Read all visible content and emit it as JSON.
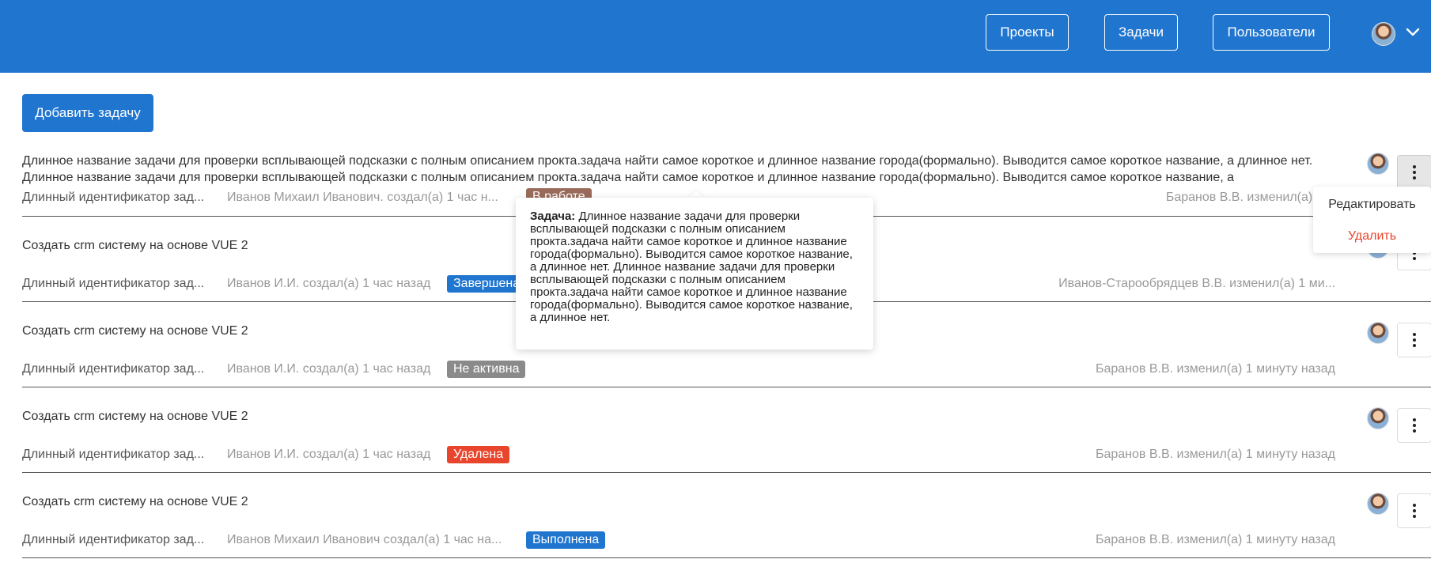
{
  "header": {
    "nav": [
      "Проекты",
      "Задачи",
      "Пользователи"
    ],
    "avatar_icon": "user-avatar",
    "dropdown_icon": "chevron-down-icon"
  },
  "add_button": "Добавить задачу",
  "tasks": [
    {
      "title": "Длинное название задачи для проверки всплывающей подсказки с полным описанием прокта.задача найти самое короткое и длинное название города(формально). Выводится самое короткое название, а длинное нет. Длинное название задачи для проверки всплывающей подсказки с полным описанием прокта.задача найти самое короткое и длинное название города(формально). Выводится самое короткое название, а",
      "identifier": "Длинный идентификатор зад...",
      "creator": "Иванов Михаил Иванович. создал(а) 1 час н...",
      "status": "В работе",
      "status_color": "#9a6b5a",
      "changer": "Баранов В.В. изменил(а) 1 м"
    },
    {
      "title": "Создать crm систему на основе VUE 2",
      "identifier": "Длинный идентификатор зад...",
      "creator": "Иванов И.И. создал(а) 1 час назад",
      "status": "Завершена",
      "status_color": "#2075cf",
      "changer": "Иванов-Старообрядцев В.В. изменил(а) 1 ми..."
    },
    {
      "title": "Создать crm систему на основе VUE 2",
      "identifier": "Длинный идентификатор зад...",
      "creator": "Иванов И.И. создал(а) 1 час назад",
      "status": "Не активна",
      "status_color": "#8a8a8a",
      "changer": "Баранов В.В. изменил(а) 1 минуту назад"
    },
    {
      "title": "Создать crm систему на основе VUE 2",
      "identifier": "Длинный идентификатор зад...",
      "creator": "Иванов И.И. создал(а) 1 час назад",
      "status": "Удалена",
      "status_color": "#e8452c",
      "changer": "Баранов В.В. изменил(а) 1 минуту назад"
    },
    {
      "title": "Создать crm систему на основе VUE 2",
      "identifier": "Длинный идентификатор зад...",
      "creator": "Иванов Михаил Иванович создал(а) 1 час на...",
      "status": "Выполнена",
      "status_color": "#2075cf",
      "changer": "Баранов В.В. изменил(а) 1 минуту назад"
    }
  ],
  "context_menu": {
    "edit": "Редактировать",
    "delete": "Удалить",
    "delete_color": "#e8452c"
  },
  "tooltip": {
    "label": "Задача:",
    "text": "Длинное название задачи для проверки всплывающей подсказки с полным описанием прокта.задача найти самое короткое и длинное название города(формально). Выводится самое короткое название, а длинное нет. Длинное название задачи для проверки всплывающей подсказки с полным описанием прокта.задача найти самое короткое и длинное название города(формально). Выводится самое короткое название, а длинное нет."
  },
  "colors": {
    "header_bg": "#2075cf",
    "primary": "#2075cf"
  }
}
